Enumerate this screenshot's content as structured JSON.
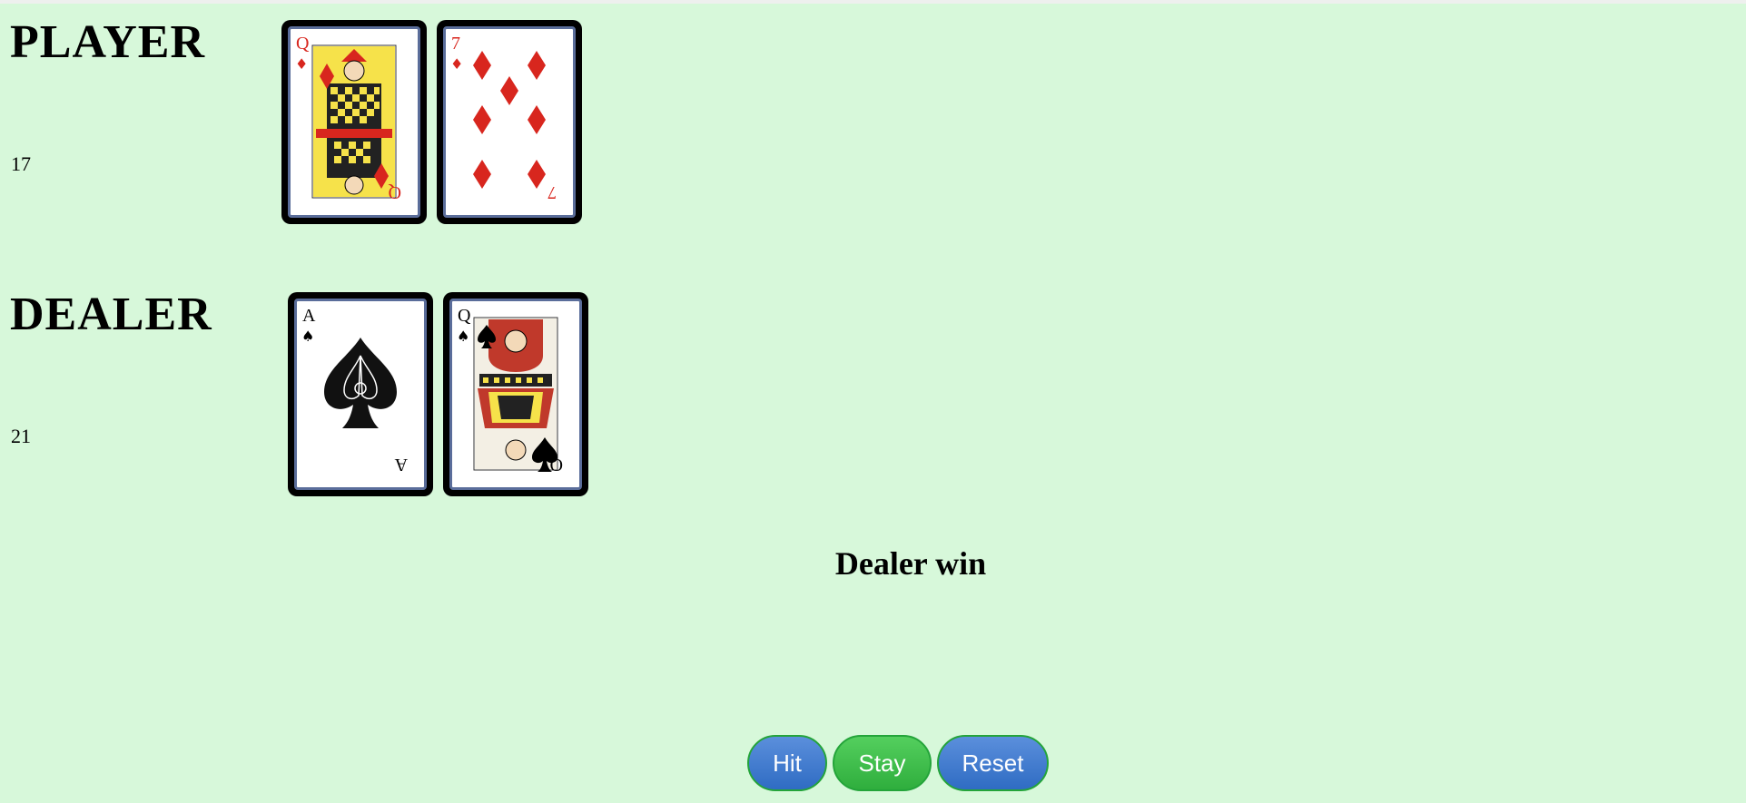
{
  "player": {
    "title": "PLAYER",
    "score": "17",
    "cards": [
      {
        "rank": "Q",
        "suit": "♦",
        "color": "#d8261e"
      },
      {
        "rank": "7",
        "suit": "♦",
        "color": "#d8261e"
      }
    ]
  },
  "dealer": {
    "title": "DEALER",
    "score": "21",
    "cards": [
      {
        "rank": "A",
        "suit": "♠",
        "color": "#000000"
      },
      {
        "rank": "Q",
        "suit": "♠",
        "color": "#000000"
      }
    ]
  },
  "result": "Dealer win",
  "controls": {
    "hit": "Hit",
    "stay": "Stay",
    "reset": "Reset"
  },
  "colors": {
    "background": "#d7f8da",
    "button_blue": "#3f7bd0",
    "button_green": "#3fbf4b"
  }
}
